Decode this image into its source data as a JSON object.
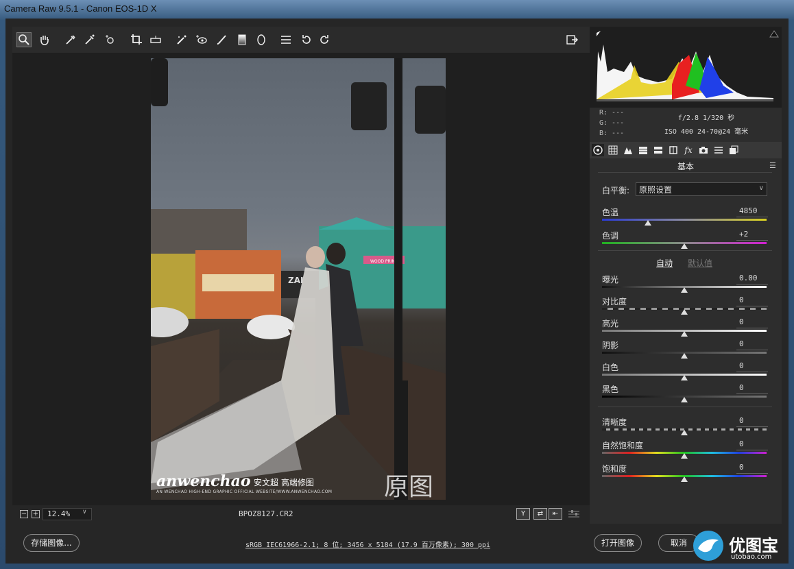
{
  "window": {
    "title": "Camera Raw 9.5.1 -  Canon EOS-1D X"
  },
  "toolbar": {
    "tools": [
      {
        "name": "zoom-tool",
        "icon": "magnifier-icon",
        "active": true
      },
      {
        "name": "hand-tool",
        "icon": "hand-icon"
      },
      {
        "name": "white-balance-tool",
        "icon": "eyedropper-icon"
      },
      {
        "name": "color-sampler-tool",
        "icon": "color-sampler-icon"
      },
      {
        "name": "targeted-adjustment-tool",
        "icon": "target-adjust-icon"
      },
      {
        "name": "crop-tool",
        "icon": "crop-icon"
      },
      {
        "name": "straighten-tool",
        "icon": "level-icon"
      },
      {
        "name": "spot-removal-tool",
        "icon": "spot-brush-icon"
      },
      {
        "name": "red-eye-tool",
        "icon": "red-eye-icon"
      },
      {
        "name": "adjustment-brush-tool",
        "icon": "brush-icon"
      },
      {
        "name": "graduated-filter-tool",
        "icon": "gradient-icon"
      },
      {
        "name": "radial-filter-tool",
        "icon": "ellipse-icon"
      },
      {
        "name": "preferences-button",
        "icon": "list-icon"
      },
      {
        "name": "rotate-ccw-button",
        "icon": "rotate-left-icon"
      },
      {
        "name": "rotate-cw-button",
        "icon": "rotate-right-icon"
      }
    ],
    "export_icon": "export-icon"
  },
  "preview": {
    "watermark_script": "anwenchao",
    "watermark_cn": "安文超 高端修图",
    "watermark_sub": "AN WENCHAO HIGH-END GRAPHIC OFFICIAL WEBSITE/WWW.ANWENCHAO.COM",
    "overlay_label": "原图",
    "sign_text": "ZAI",
    "shop_sign": "WOOD PRINT"
  },
  "status": {
    "zoom_out": "−",
    "zoom_in": "+",
    "zoom_value": "12.4%",
    "zoom_dropdown": "∨",
    "filename": "BPOZ8127.CR2",
    "view_buttons": [
      "Y",
      "⇄",
      "⇤"
    ]
  },
  "bottom": {
    "save_label": "存储图像...",
    "workflow_link": "sRGB IEC61966-2.1; 8 位; 3456 x 5184 (17.9 百万像素); 300 ppi",
    "open_label": "打开图像",
    "cancel_label": "取消",
    "logo_text": "优图宝",
    "logo_url": "utobao.com"
  },
  "histogram": {
    "rgb": {
      "r": "R:  ---",
      "g": "G:  ---",
      "b": "B:  ---"
    },
    "aperture_shutter": "f/2.8  1/320 秒",
    "iso_lens": "ISO 400  24-70@24 毫米"
  },
  "panel": {
    "tabs": [
      "aperture-icon",
      "tone-curve-icon",
      "detail-icon",
      "hsl-icon",
      "split-tone-icon",
      "lens-icon",
      "fx-icon",
      "camera-calibration-icon",
      "presets-icon",
      "snapshots-icon"
    ],
    "title": "基本",
    "white_balance_label": "白平衡:",
    "white_balance_value": "原照设置",
    "auto_label": "自动",
    "default_label": "默认值",
    "sliders": [
      {
        "key": "temp",
        "label": "色温",
        "value": "4850",
        "pos": 0.28
      },
      {
        "key": "tint",
        "label": "色调",
        "value": "+2",
        "pos": 0.5
      },
      {
        "key": "exposure",
        "label": "曝光",
        "value": "0.00",
        "pos": 0.5
      },
      {
        "key": "contrast",
        "label": "对比度",
        "value": "0",
        "pos": 0.5
      },
      {
        "key": "highlights",
        "label": "高光",
        "value": "0",
        "pos": 0.5
      },
      {
        "key": "shadows",
        "label": "阴影",
        "value": "0",
        "pos": 0.5
      },
      {
        "key": "whites",
        "label": "白色",
        "value": "0",
        "pos": 0.5
      },
      {
        "key": "blacks",
        "label": "黑色",
        "value": "0",
        "pos": 0.5
      },
      {
        "key": "clarity",
        "label": "清晰度",
        "value": "0",
        "pos": 0.5
      },
      {
        "key": "vibrance",
        "label": "自然饱和度",
        "value": "0",
        "pos": 0.5
      },
      {
        "key": "saturation",
        "label": "饱和度",
        "value": "0",
        "pos": 0.5
      }
    ]
  },
  "colors": {
    "accent": "#2e9fd8",
    "panel": "#2d2d2d"
  }
}
